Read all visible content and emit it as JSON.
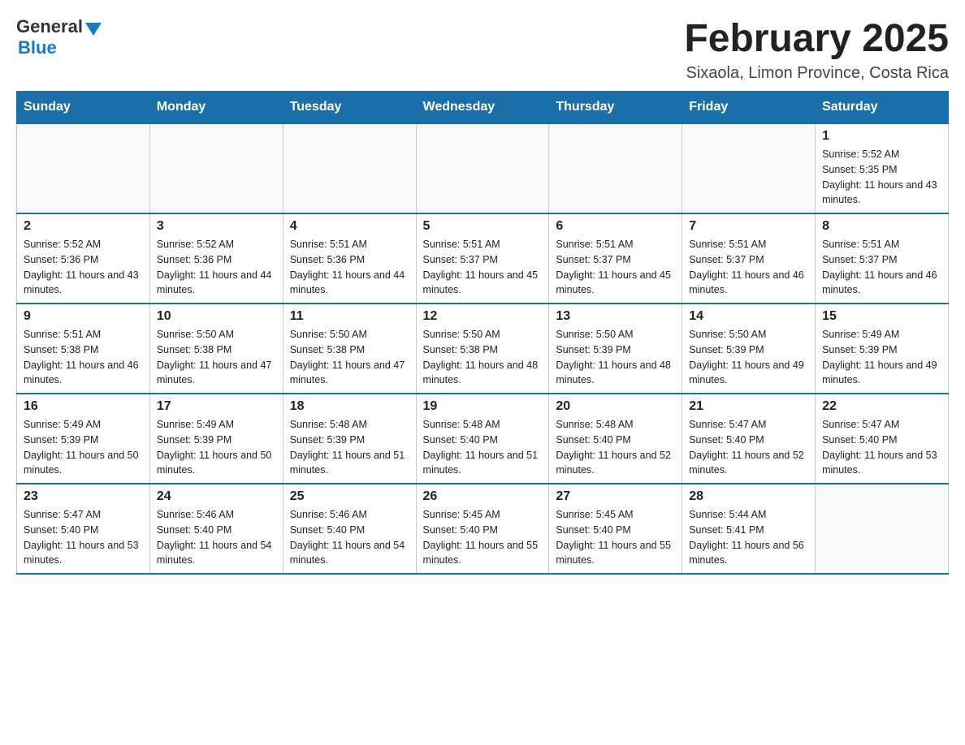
{
  "header": {
    "logo": {
      "general": "General",
      "blue": "Blue"
    },
    "title": "February 2025",
    "subtitle": "Sixaola, Limon Province, Costa Rica"
  },
  "days_of_week": [
    "Sunday",
    "Monday",
    "Tuesday",
    "Wednesday",
    "Thursday",
    "Friday",
    "Saturday"
  ],
  "weeks": [
    [
      {
        "day": "",
        "info": ""
      },
      {
        "day": "",
        "info": ""
      },
      {
        "day": "",
        "info": ""
      },
      {
        "day": "",
        "info": ""
      },
      {
        "day": "",
        "info": ""
      },
      {
        "day": "",
        "info": ""
      },
      {
        "day": "1",
        "info": "Sunrise: 5:52 AM\nSunset: 5:35 PM\nDaylight: 11 hours and 43 minutes."
      }
    ],
    [
      {
        "day": "2",
        "info": "Sunrise: 5:52 AM\nSunset: 5:36 PM\nDaylight: 11 hours and 43 minutes."
      },
      {
        "day": "3",
        "info": "Sunrise: 5:52 AM\nSunset: 5:36 PM\nDaylight: 11 hours and 44 minutes."
      },
      {
        "day": "4",
        "info": "Sunrise: 5:51 AM\nSunset: 5:36 PM\nDaylight: 11 hours and 44 minutes."
      },
      {
        "day": "5",
        "info": "Sunrise: 5:51 AM\nSunset: 5:37 PM\nDaylight: 11 hours and 45 minutes."
      },
      {
        "day": "6",
        "info": "Sunrise: 5:51 AM\nSunset: 5:37 PM\nDaylight: 11 hours and 45 minutes."
      },
      {
        "day": "7",
        "info": "Sunrise: 5:51 AM\nSunset: 5:37 PM\nDaylight: 11 hours and 46 minutes."
      },
      {
        "day": "8",
        "info": "Sunrise: 5:51 AM\nSunset: 5:37 PM\nDaylight: 11 hours and 46 minutes."
      }
    ],
    [
      {
        "day": "9",
        "info": "Sunrise: 5:51 AM\nSunset: 5:38 PM\nDaylight: 11 hours and 46 minutes."
      },
      {
        "day": "10",
        "info": "Sunrise: 5:50 AM\nSunset: 5:38 PM\nDaylight: 11 hours and 47 minutes."
      },
      {
        "day": "11",
        "info": "Sunrise: 5:50 AM\nSunset: 5:38 PM\nDaylight: 11 hours and 47 minutes."
      },
      {
        "day": "12",
        "info": "Sunrise: 5:50 AM\nSunset: 5:38 PM\nDaylight: 11 hours and 48 minutes."
      },
      {
        "day": "13",
        "info": "Sunrise: 5:50 AM\nSunset: 5:39 PM\nDaylight: 11 hours and 48 minutes."
      },
      {
        "day": "14",
        "info": "Sunrise: 5:50 AM\nSunset: 5:39 PM\nDaylight: 11 hours and 49 minutes."
      },
      {
        "day": "15",
        "info": "Sunrise: 5:49 AM\nSunset: 5:39 PM\nDaylight: 11 hours and 49 minutes."
      }
    ],
    [
      {
        "day": "16",
        "info": "Sunrise: 5:49 AM\nSunset: 5:39 PM\nDaylight: 11 hours and 50 minutes."
      },
      {
        "day": "17",
        "info": "Sunrise: 5:49 AM\nSunset: 5:39 PM\nDaylight: 11 hours and 50 minutes."
      },
      {
        "day": "18",
        "info": "Sunrise: 5:48 AM\nSunset: 5:39 PM\nDaylight: 11 hours and 51 minutes."
      },
      {
        "day": "19",
        "info": "Sunrise: 5:48 AM\nSunset: 5:40 PM\nDaylight: 11 hours and 51 minutes."
      },
      {
        "day": "20",
        "info": "Sunrise: 5:48 AM\nSunset: 5:40 PM\nDaylight: 11 hours and 52 minutes."
      },
      {
        "day": "21",
        "info": "Sunrise: 5:47 AM\nSunset: 5:40 PM\nDaylight: 11 hours and 52 minutes."
      },
      {
        "day": "22",
        "info": "Sunrise: 5:47 AM\nSunset: 5:40 PM\nDaylight: 11 hours and 53 minutes."
      }
    ],
    [
      {
        "day": "23",
        "info": "Sunrise: 5:47 AM\nSunset: 5:40 PM\nDaylight: 11 hours and 53 minutes."
      },
      {
        "day": "24",
        "info": "Sunrise: 5:46 AM\nSunset: 5:40 PM\nDaylight: 11 hours and 54 minutes."
      },
      {
        "day": "25",
        "info": "Sunrise: 5:46 AM\nSunset: 5:40 PM\nDaylight: 11 hours and 54 minutes."
      },
      {
        "day": "26",
        "info": "Sunrise: 5:45 AM\nSunset: 5:40 PM\nDaylight: 11 hours and 55 minutes."
      },
      {
        "day": "27",
        "info": "Sunrise: 5:45 AM\nSunset: 5:40 PM\nDaylight: 11 hours and 55 minutes."
      },
      {
        "day": "28",
        "info": "Sunrise: 5:44 AM\nSunset: 5:41 PM\nDaylight: 11 hours and 56 minutes."
      },
      {
        "day": "",
        "info": ""
      }
    ]
  ]
}
